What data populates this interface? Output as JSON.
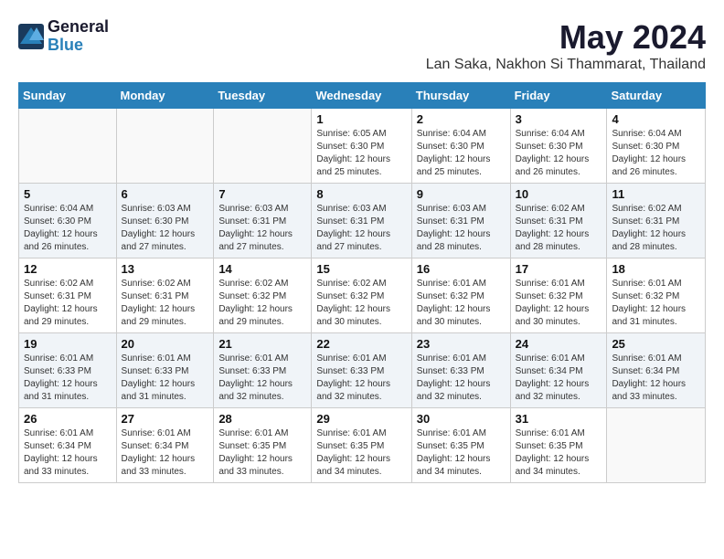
{
  "app": {
    "logo_general": "General",
    "logo_blue": "Blue"
  },
  "header": {
    "month": "May 2024",
    "location": "Lan Saka, Nakhon Si Thammarat, Thailand"
  },
  "weekdays": [
    "Sunday",
    "Monday",
    "Tuesday",
    "Wednesday",
    "Thursday",
    "Friday",
    "Saturday"
  ],
  "weeks": [
    [
      {
        "day": "",
        "info": ""
      },
      {
        "day": "",
        "info": ""
      },
      {
        "day": "",
        "info": ""
      },
      {
        "day": "1",
        "info": "Sunrise: 6:05 AM\nSunset: 6:30 PM\nDaylight: 12 hours\nand 25 minutes."
      },
      {
        "day": "2",
        "info": "Sunrise: 6:04 AM\nSunset: 6:30 PM\nDaylight: 12 hours\nand 25 minutes."
      },
      {
        "day": "3",
        "info": "Sunrise: 6:04 AM\nSunset: 6:30 PM\nDaylight: 12 hours\nand 26 minutes."
      },
      {
        "day": "4",
        "info": "Sunrise: 6:04 AM\nSunset: 6:30 PM\nDaylight: 12 hours\nand 26 minutes."
      }
    ],
    [
      {
        "day": "5",
        "info": "Sunrise: 6:04 AM\nSunset: 6:30 PM\nDaylight: 12 hours\nand 26 minutes."
      },
      {
        "day": "6",
        "info": "Sunrise: 6:03 AM\nSunset: 6:30 PM\nDaylight: 12 hours\nand 27 minutes."
      },
      {
        "day": "7",
        "info": "Sunrise: 6:03 AM\nSunset: 6:31 PM\nDaylight: 12 hours\nand 27 minutes."
      },
      {
        "day": "8",
        "info": "Sunrise: 6:03 AM\nSunset: 6:31 PM\nDaylight: 12 hours\nand 27 minutes."
      },
      {
        "day": "9",
        "info": "Sunrise: 6:03 AM\nSunset: 6:31 PM\nDaylight: 12 hours\nand 28 minutes."
      },
      {
        "day": "10",
        "info": "Sunrise: 6:02 AM\nSunset: 6:31 PM\nDaylight: 12 hours\nand 28 minutes."
      },
      {
        "day": "11",
        "info": "Sunrise: 6:02 AM\nSunset: 6:31 PM\nDaylight: 12 hours\nand 28 minutes."
      }
    ],
    [
      {
        "day": "12",
        "info": "Sunrise: 6:02 AM\nSunset: 6:31 PM\nDaylight: 12 hours\nand 29 minutes."
      },
      {
        "day": "13",
        "info": "Sunrise: 6:02 AM\nSunset: 6:31 PM\nDaylight: 12 hours\nand 29 minutes."
      },
      {
        "day": "14",
        "info": "Sunrise: 6:02 AM\nSunset: 6:32 PM\nDaylight: 12 hours\nand 29 minutes."
      },
      {
        "day": "15",
        "info": "Sunrise: 6:02 AM\nSunset: 6:32 PM\nDaylight: 12 hours\nand 30 minutes."
      },
      {
        "day": "16",
        "info": "Sunrise: 6:01 AM\nSunset: 6:32 PM\nDaylight: 12 hours\nand 30 minutes."
      },
      {
        "day": "17",
        "info": "Sunrise: 6:01 AM\nSunset: 6:32 PM\nDaylight: 12 hours\nand 30 minutes."
      },
      {
        "day": "18",
        "info": "Sunrise: 6:01 AM\nSunset: 6:32 PM\nDaylight: 12 hours\nand 31 minutes."
      }
    ],
    [
      {
        "day": "19",
        "info": "Sunrise: 6:01 AM\nSunset: 6:33 PM\nDaylight: 12 hours\nand 31 minutes."
      },
      {
        "day": "20",
        "info": "Sunrise: 6:01 AM\nSunset: 6:33 PM\nDaylight: 12 hours\nand 31 minutes."
      },
      {
        "day": "21",
        "info": "Sunrise: 6:01 AM\nSunset: 6:33 PM\nDaylight: 12 hours\nand 32 minutes."
      },
      {
        "day": "22",
        "info": "Sunrise: 6:01 AM\nSunset: 6:33 PM\nDaylight: 12 hours\nand 32 minutes."
      },
      {
        "day": "23",
        "info": "Sunrise: 6:01 AM\nSunset: 6:33 PM\nDaylight: 12 hours\nand 32 minutes."
      },
      {
        "day": "24",
        "info": "Sunrise: 6:01 AM\nSunset: 6:34 PM\nDaylight: 12 hours\nand 32 minutes."
      },
      {
        "day": "25",
        "info": "Sunrise: 6:01 AM\nSunset: 6:34 PM\nDaylight: 12 hours\nand 33 minutes."
      }
    ],
    [
      {
        "day": "26",
        "info": "Sunrise: 6:01 AM\nSunset: 6:34 PM\nDaylight: 12 hours\nand 33 minutes."
      },
      {
        "day": "27",
        "info": "Sunrise: 6:01 AM\nSunset: 6:34 PM\nDaylight: 12 hours\nand 33 minutes."
      },
      {
        "day": "28",
        "info": "Sunrise: 6:01 AM\nSunset: 6:35 PM\nDaylight: 12 hours\nand 33 minutes."
      },
      {
        "day": "29",
        "info": "Sunrise: 6:01 AM\nSunset: 6:35 PM\nDaylight: 12 hours\nand 34 minutes."
      },
      {
        "day": "30",
        "info": "Sunrise: 6:01 AM\nSunset: 6:35 PM\nDaylight: 12 hours\nand 34 minutes."
      },
      {
        "day": "31",
        "info": "Sunrise: 6:01 AM\nSunset: 6:35 PM\nDaylight: 12 hours\nand 34 minutes."
      },
      {
        "day": "",
        "info": ""
      }
    ]
  ]
}
